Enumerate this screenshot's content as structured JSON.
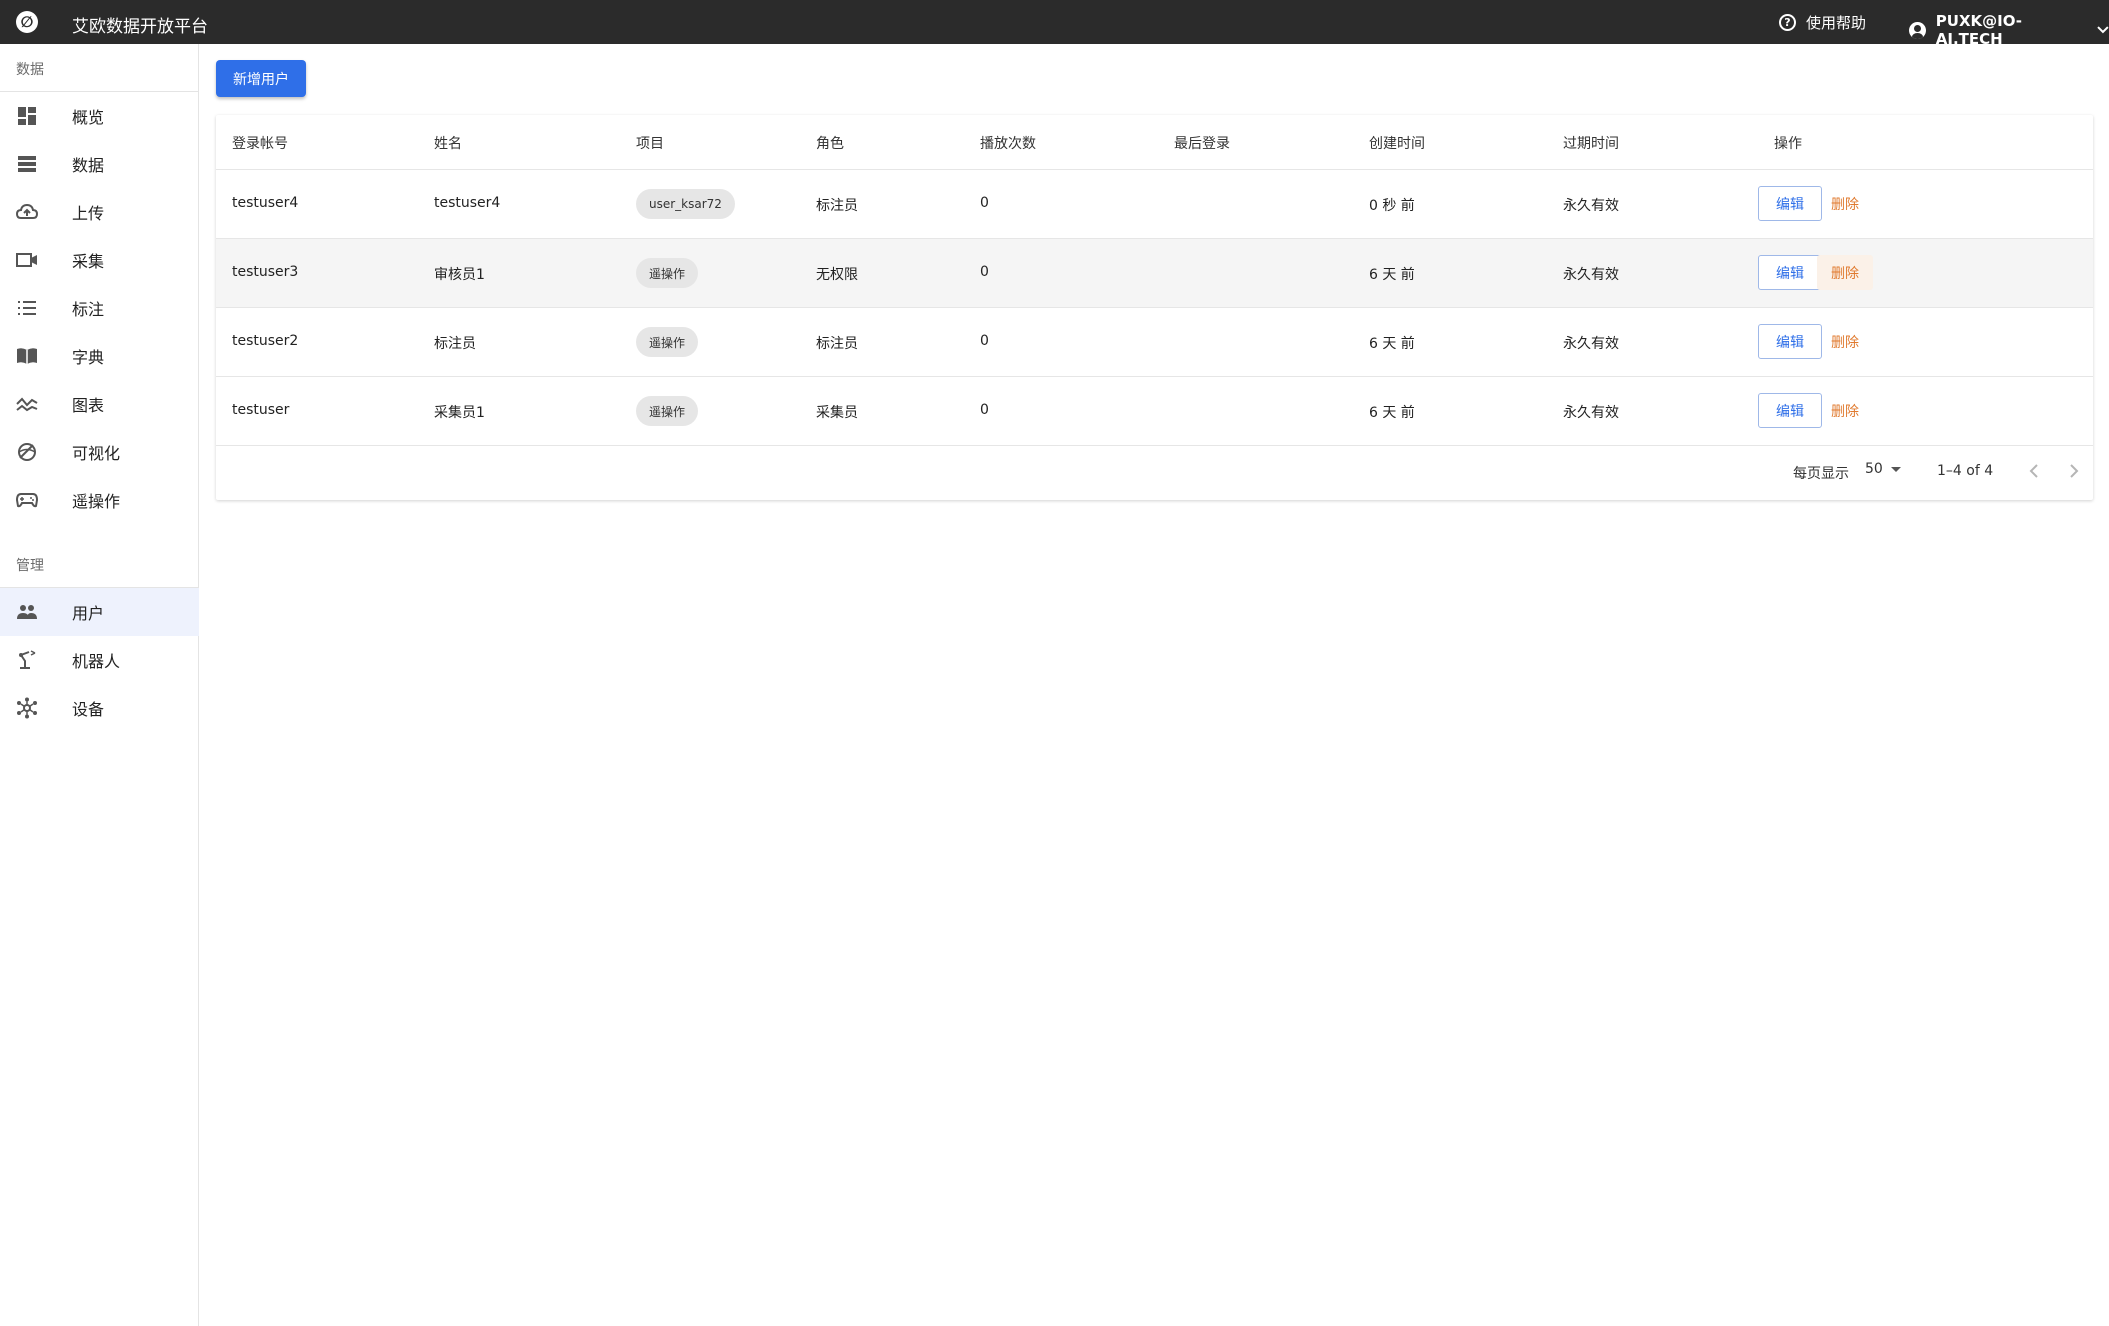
{
  "app": {
    "title": "艾欧数据开放平台",
    "logo_glyph": "∅"
  },
  "topbar": {
    "help_label": "使用帮助",
    "user_label": "PUXK@IO-AI.TECH"
  },
  "sidebar": {
    "section_data": "数据",
    "section_admin": "管理",
    "items": [
      {
        "label": "概览",
        "icon": "dashboard-icon"
      },
      {
        "label": "数据",
        "icon": "storage-icon"
      },
      {
        "label": "上传",
        "icon": "cloud-upload-icon"
      },
      {
        "label": "采集",
        "icon": "video-capture-icon"
      },
      {
        "label": "标注",
        "icon": "list-numbered-icon"
      },
      {
        "label": "字典",
        "icon": "book-icon"
      },
      {
        "label": "图表",
        "icon": "line-chart-icon"
      },
      {
        "label": "可视化",
        "icon": "visualization-icon"
      },
      {
        "label": "遥操作",
        "icon": "gamepad-icon"
      }
    ],
    "admin_items": [
      {
        "label": "用户",
        "icon": "people-icon",
        "active": true
      },
      {
        "label": "机器人",
        "icon": "robot-arm-icon"
      },
      {
        "label": "设备",
        "icon": "hub-icon"
      }
    ]
  },
  "main": {
    "add_user_label": "新增用户"
  },
  "table": {
    "headers": [
      "登录帐号",
      "姓名",
      "项目",
      "角色",
      "播放次数",
      "最后登录",
      "创建时间",
      "过期时间",
      "操作"
    ],
    "rows": [
      {
        "account": "testuser4",
        "name": "testuser4",
        "project": "user_ksar72",
        "role": "标注员",
        "plays": "0",
        "last_login": "",
        "created": "0 秒 前",
        "expires": "永久有效"
      },
      {
        "account": "testuser3",
        "name": "审核员1",
        "project": "遥操作",
        "role": "无权限",
        "plays": "0",
        "last_login": "",
        "created": "6 天 前",
        "expires": "永久有效"
      },
      {
        "account": "testuser2",
        "name": "标注员",
        "project": "遥操作",
        "role": "标注员",
        "plays": "0",
        "last_login": "",
        "created": "6 天 前",
        "expires": "永久有效"
      },
      {
        "account": "testuser",
        "name": "采集员1",
        "project": "遥操作",
        "role": "采集员",
        "plays": "0",
        "last_login": "",
        "created": "6 天 前",
        "expires": "永久有效"
      }
    ],
    "edit_label": "编辑",
    "delete_label": "删除"
  },
  "pagination": {
    "per_page_label": "每页显示",
    "per_page_value": "50",
    "range": "1–4 of 4",
    "prev_glyph": "‹",
    "next_glyph": "›"
  },
  "colors": {
    "primary": "#2f6fe8",
    "danger": "#e07a2f",
    "topbar": "#2b2b2b",
    "active_nav": "#eef2fd"
  }
}
